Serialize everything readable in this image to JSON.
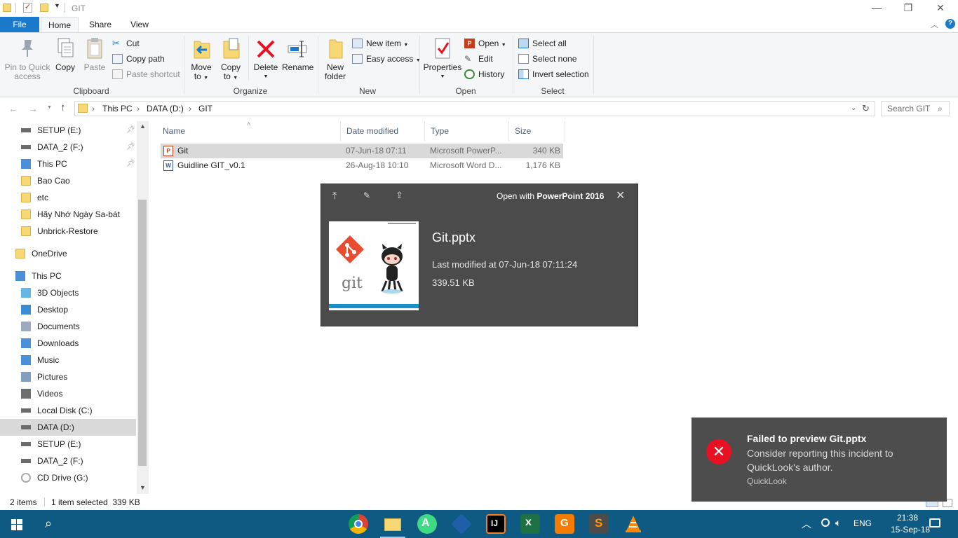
{
  "window": {
    "title": "GIT",
    "minimize_glyph": "—",
    "maximize_glyph": "❐",
    "close_glyph": "✕"
  },
  "tabs": [
    {
      "label": "File"
    },
    {
      "label": "Home"
    },
    {
      "label": "Share"
    },
    {
      "label": "View"
    }
  ],
  "ribbon": {
    "clipboard": {
      "label": "Clipboard",
      "pin_label_1": "Pin to Quick",
      "pin_label_2": "access",
      "copy_label": "Copy",
      "paste_label": "Paste",
      "cut_label": "Cut",
      "copy_path_label": "Copy path",
      "paste_shortcut_label": "Paste shortcut"
    },
    "organize": {
      "label": "Organize",
      "move_to_1": "Move",
      "move_to_2": "to",
      "copy_to_1": "Copy",
      "copy_to_2": "to",
      "delete_label": "Delete",
      "rename_label": "Rename"
    },
    "new": {
      "label": "New",
      "new_folder_1": "New",
      "new_folder_2": "folder",
      "new_item_label": "New item",
      "easy_access_label": "Easy access"
    },
    "open": {
      "label": "Open",
      "properties_label": "Properties",
      "open_label": "Open",
      "edit_label": "Edit",
      "history_label": "History"
    },
    "select": {
      "label": "Select",
      "select_all_label": "Select all",
      "select_none_label": "Select none",
      "invert_label": "Invert selection"
    }
  },
  "address": {
    "crumbs": [
      "This PC",
      "DATA (D:)",
      "GIT"
    ],
    "search_placeholder": "Search GIT"
  },
  "nav": {
    "items": [
      {
        "label": "SETUP (E:)",
        "icon": "drive-icon",
        "pinned": true
      },
      {
        "label": "DATA_2 (F:)",
        "icon": "drive-icon",
        "pinned": true
      },
      {
        "label": "This PC",
        "icon": "computer-icon",
        "pinned": true
      },
      {
        "label": "Bao Cao",
        "icon": "folder-icon",
        "pinned": false
      },
      {
        "label": "etc",
        "icon": "folder-icon",
        "pinned": false
      },
      {
        "label": "Hãy Nhớ Ngày Sa-bát",
        "icon": "folder-icon",
        "pinned": false
      },
      {
        "label": "Unbrick-Restore",
        "icon": "folder-icon",
        "pinned": false
      },
      {
        "label": "OneDrive",
        "icon": "folder-icon",
        "pinned": false
      },
      {
        "label": "This PC",
        "icon": "computer-icon",
        "pinned": false
      },
      {
        "label": "3D Objects",
        "icon": "cube-icon",
        "pinned": false
      },
      {
        "label": "Desktop",
        "icon": "desktop-icon",
        "pinned": false
      },
      {
        "label": "Documents",
        "icon": "documents-icon",
        "pinned": false
      },
      {
        "label": "Downloads",
        "icon": "download-icon",
        "pinned": false
      },
      {
        "label": "Music",
        "icon": "music-icon",
        "pinned": false
      },
      {
        "label": "Pictures",
        "icon": "pictures-icon",
        "pinned": false
      },
      {
        "label": "Videos",
        "icon": "videos-icon",
        "pinned": false
      },
      {
        "label": "Local Disk (C:)",
        "icon": "drive-icon",
        "pinned": false
      },
      {
        "label": "DATA (D:)",
        "icon": "drive-icon",
        "pinned": false
      },
      {
        "label": "SETUP (E:)",
        "icon": "drive-icon",
        "pinned": false
      },
      {
        "label": "DATA_2 (F:)",
        "icon": "drive-icon",
        "pinned": false
      },
      {
        "label": "CD Drive (G:)",
        "icon": "cd-icon",
        "pinned": false
      }
    ]
  },
  "columns": {
    "name": "Name",
    "date": "Date modified",
    "type": "Type",
    "size": "Size"
  },
  "files": [
    {
      "name": "Git",
      "date": "07-Jun-18 07:11",
      "type": "Microsoft PowerP...",
      "size": "340 KB"
    },
    {
      "name": "Guidline GIT_v0.1",
      "date": "26-Aug-18 10:10",
      "type": "Microsoft Word D...",
      "size": "1,176 KB"
    }
  ],
  "status": {
    "count": "2 items",
    "selection": "1 item selected  339 KB"
  },
  "quicklook": {
    "open_with_prefix": "Open with ",
    "open_with_app": "PowerPoint 2016",
    "filename": "Git.pptx",
    "modified": "Last modified at 07-Jun-18 07:11:24",
    "size": "339.51 KB",
    "thumb_caption": "git"
  },
  "toast": {
    "title": "Failed to preview Git.pptx",
    "message": "Consider reporting this incident to QuickLook's author.",
    "source": "QuickLook"
  },
  "taskbar": {
    "lang": "ENG",
    "time": "21:38",
    "date": "15-Sep-18"
  },
  "colors": {
    "accent": "#1979ca",
    "taskbar": "#0e5a82",
    "folder": "#f8d775",
    "delete_red": "#e81123"
  }
}
